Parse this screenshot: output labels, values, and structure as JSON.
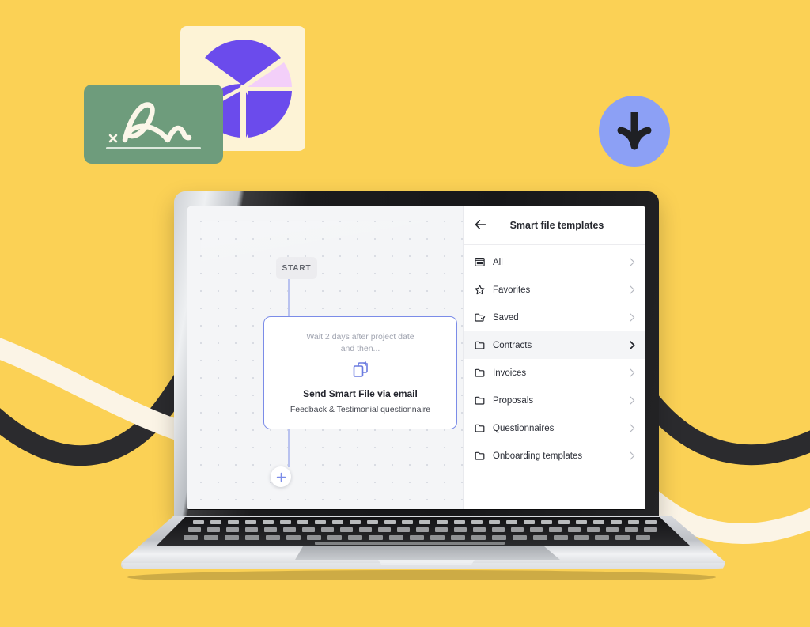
{
  "scene": {
    "background_color": "#FBD155",
    "decor": {
      "pie_card": {
        "name": "pie-chart-graphic",
        "card_color": "#FDF3D6",
        "slice_primary_color": "#6B4BEC",
        "slice_accent_color": "#F3CFF9"
      },
      "signature_card": {
        "name": "signature-graphic",
        "card_color": "#6E9C7C",
        "ink_color": "#FBF6E9",
        "x_mark": "×"
      },
      "download_badge": {
        "name": "download-arrow-graphic",
        "circle_color": "#8CA0F5",
        "arrow_color": "#1F2024"
      },
      "ribbons": {
        "dark_color": "#2B2B2E",
        "cream_color": "#FBF4E6"
      }
    },
    "laptop": {
      "body_color": "#C9CCD1",
      "bezel_color": "#131315"
    }
  },
  "app": {
    "canvas": {
      "start_label": "START",
      "add_step_label": "+",
      "workflow_card": {
        "wait_text_line1": "Wait 2 days after project date",
        "wait_text_line2": "and then...",
        "icon": "smart-file-icon",
        "title": "Send Smart File via email",
        "subtitle": "Feedback & Testimonial questionnaire",
        "border_color": "#7b8ce8"
      }
    },
    "panel": {
      "back_icon": "back-arrow-icon",
      "title": "Smart file templates",
      "items": [
        {
          "label": "All",
          "icon": "book-icon",
          "active": false
        },
        {
          "label": "Favorites",
          "icon": "star-icon",
          "active": false
        },
        {
          "label": "Saved",
          "icon": "folder-check-icon",
          "active": false
        },
        {
          "label": "Contracts",
          "icon": "folder-icon",
          "active": true
        },
        {
          "label": "Invoices",
          "icon": "folder-icon",
          "active": false
        },
        {
          "label": "Proposals",
          "icon": "folder-icon",
          "active": false
        },
        {
          "label": "Questionnaires",
          "icon": "folder-icon",
          "active": false
        },
        {
          "label": "Onboarding templates",
          "icon": "folder-icon",
          "active": false
        }
      ]
    }
  }
}
